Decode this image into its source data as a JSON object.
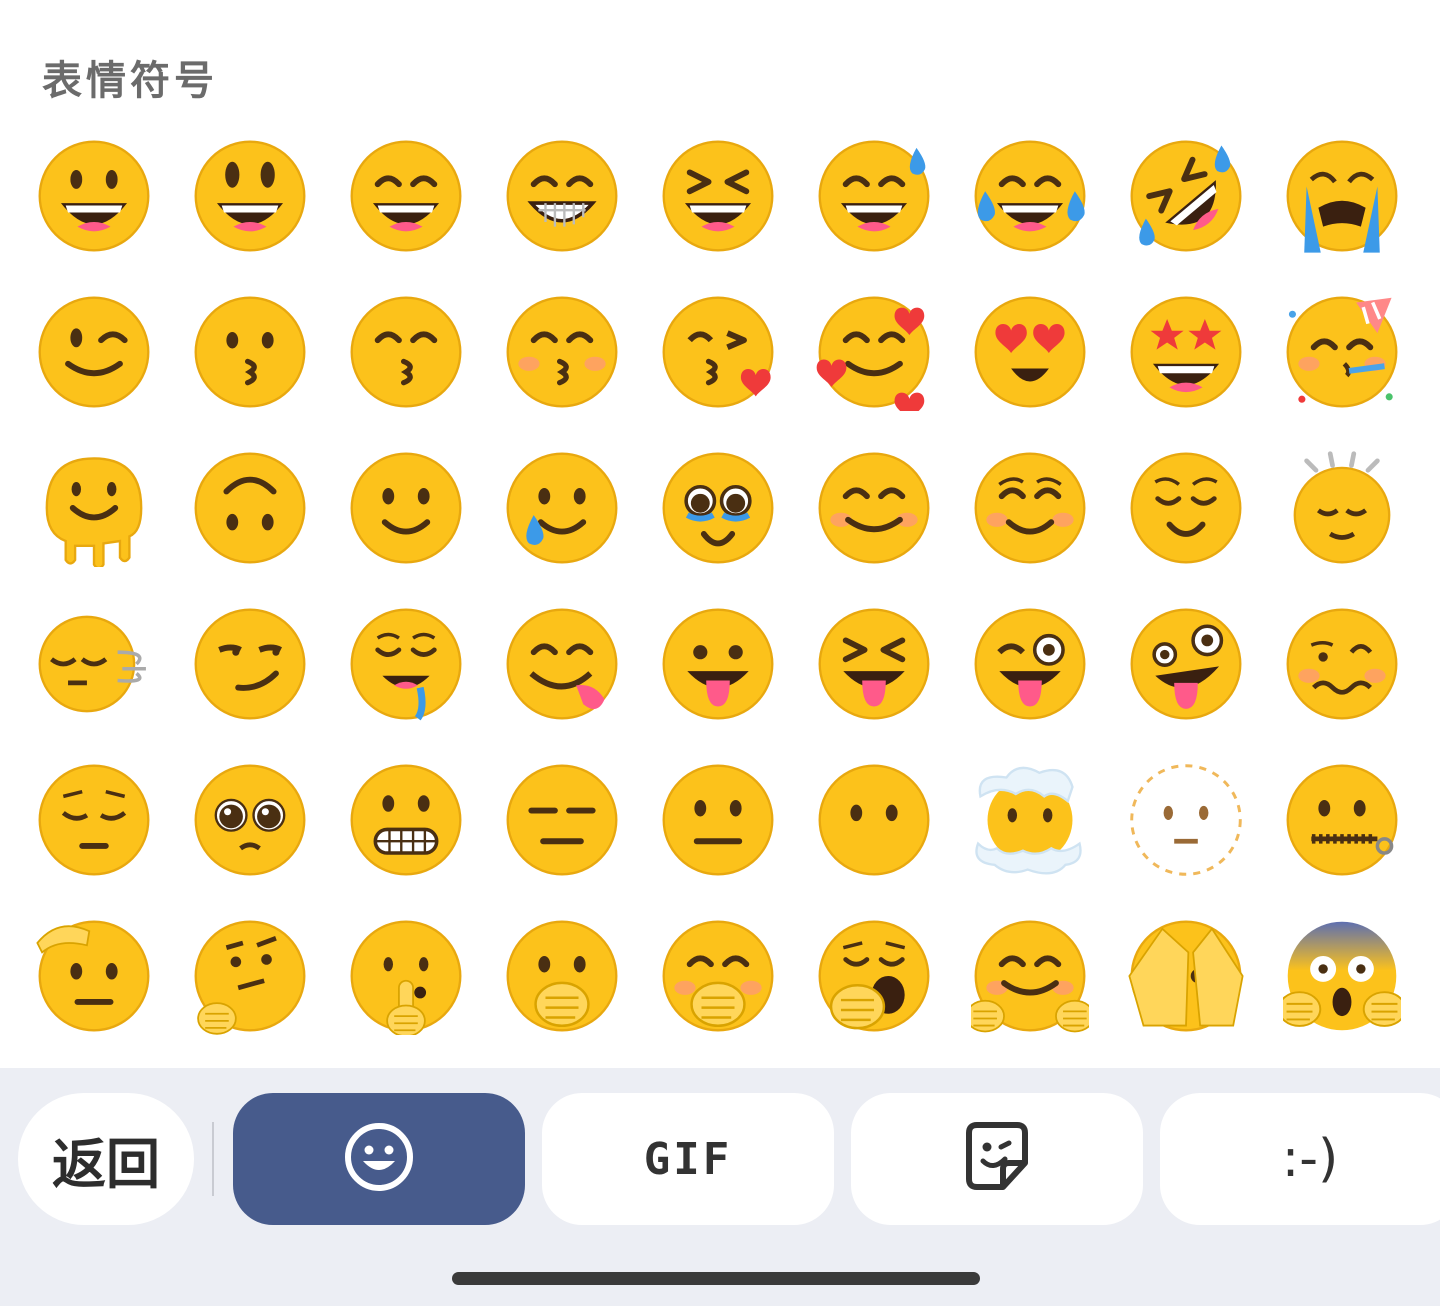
{
  "header": {
    "title": "表情符号"
  },
  "emojis": [
    {
      "icon": "grinning-face-icon"
    },
    {
      "icon": "grinning-face-with-big-eyes-icon"
    },
    {
      "icon": "grinning-face-with-smiling-eyes-icon"
    },
    {
      "icon": "beaming-face-icon"
    },
    {
      "icon": "grinning-squinting-face-icon"
    },
    {
      "icon": "grinning-face-with-sweat-icon"
    },
    {
      "icon": "face-with-tears-of-joy-icon"
    },
    {
      "icon": "rolling-on-the-floor-laughing-icon"
    },
    {
      "icon": "loudly-crying-face-icon"
    },
    {
      "icon": "winking-face-icon"
    },
    {
      "icon": "kissing-face-icon"
    },
    {
      "icon": "kissing-face-with-smiling-eyes-icon"
    },
    {
      "icon": "kissing-face-with-closed-eyes-icon"
    },
    {
      "icon": "face-blowing-a-kiss-icon"
    },
    {
      "icon": "smiling-face-with-hearts-icon"
    },
    {
      "icon": "smiling-face-with-heart-eyes-icon"
    },
    {
      "icon": "star-struck-icon"
    },
    {
      "icon": "partying-face-icon"
    },
    {
      "icon": "melting-face-icon"
    },
    {
      "icon": "upside-down-face-icon"
    },
    {
      "icon": "slightly-smiling-face-icon"
    },
    {
      "icon": "smiling-face-with-tear-icon"
    },
    {
      "icon": "face-holding-back-tears-icon"
    },
    {
      "icon": "smiling-face-with-smiling-eyes-icon"
    },
    {
      "icon": "smiling-face-icon"
    },
    {
      "icon": "relieved-face-icon"
    },
    {
      "icon": "shaking-face-icon"
    },
    {
      "icon": "face-exhaling-icon"
    },
    {
      "icon": "smirking-face-icon"
    },
    {
      "icon": "drooling-face-icon"
    },
    {
      "icon": "face-savoring-food-icon"
    },
    {
      "icon": "face-with-tongue-icon"
    },
    {
      "icon": "squinting-face-with-tongue-icon"
    },
    {
      "icon": "winking-face-with-tongue-icon"
    },
    {
      "icon": "zany-face-icon"
    },
    {
      "icon": "woozy-face-icon"
    },
    {
      "icon": "pensive-face-icon"
    },
    {
      "icon": "pleading-face-icon"
    },
    {
      "icon": "grimacing-face-icon"
    },
    {
      "icon": "expressionless-face-icon"
    },
    {
      "icon": "neutral-face-icon"
    },
    {
      "icon": "face-without-mouth-icon"
    },
    {
      "icon": "face-in-clouds-icon"
    },
    {
      "icon": "dotted-line-face-icon"
    },
    {
      "icon": "zipper-mouth-face-icon"
    },
    {
      "icon": "saluting-face-icon"
    },
    {
      "icon": "thinking-face-icon"
    },
    {
      "icon": "shushing-face-icon"
    },
    {
      "icon": "face-with-open-eyes-and-hand-over-mouth-icon"
    },
    {
      "icon": "face-with-hand-over-mouth-icon"
    },
    {
      "icon": "yawning-face-icon"
    },
    {
      "icon": "hugging-face-icon"
    },
    {
      "icon": "face-with-peeking-eye-icon"
    },
    {
      "icon": "face-screaming-in-fear-icon"
    }
  ],
  "toolbar": {
    "back_label": "返回",
    "gif_label": "GIF",
    "emoticon_label": ":-)",
    "emoji_tab_icon": "smiley-outline-icon",
    "sticker_tab_icon": "sticker-icon"
  },
  "colors": {
    "face": "#fcc21b",
    "face_edge": "#e8a80f",
    "feature": "#4a2f12",
    "mouth": "#3a2010",
    "tongue": "#ff5a8a",
    "tear": "#3c9ae8",
    "heart": "#ef3a3a",
    "blush": "#ff8e8e",
    "hand": "#ffd65a",
    "active_tab": "#475b8c",
    "bar_bg": "#eceef4"
  }
}
